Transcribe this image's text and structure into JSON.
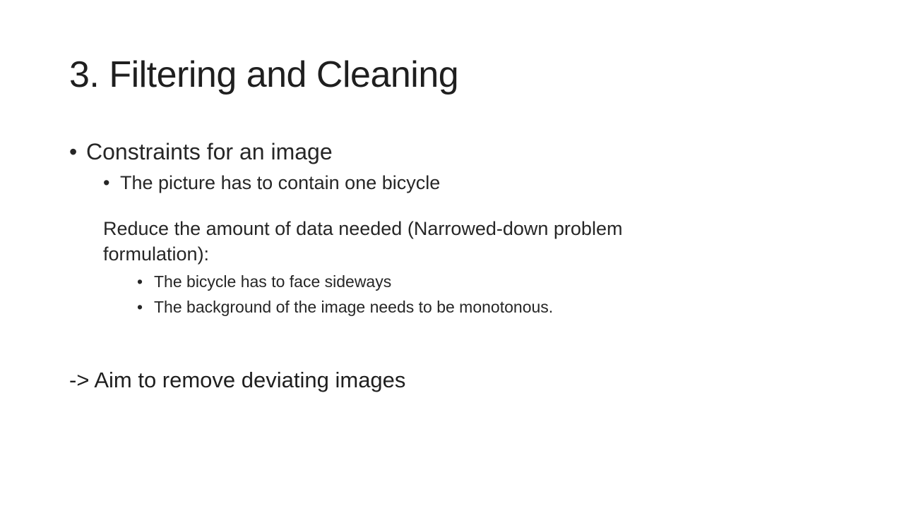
{
  "slide": {
    "title": "3. Filtering and Cleaning",
    "bullet_glyph": "•",
    "items": {
      "constraints": "Constraints for an image",
      "one_bicycle": "The picture has to contain one bicycle",
      "reduce_paragraph": "Reduce the amount of data needed (Narrowed-down problem formulation):",
      "face_sideways": "The bicycle has to face sideways",
      "monotonous_background": "The background of the image needs to be monotonous."
    },
    "aim": "-> Aim to remove deviating images"
  }
}
